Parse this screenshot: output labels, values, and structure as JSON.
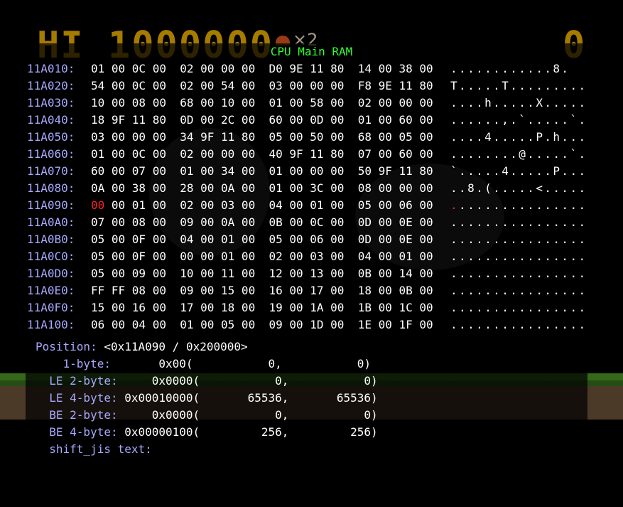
{
  "game": {
    "hi_label": "HI",
    "hi_score": "1000000",
    "lives": "×2",
    "score": "0"
  },
  "title": "CPU Main RAM",
  "rows": [
    {
      "addr": "11A010:",
      "b1": "01 00 0C 00",
      "b2": "02 00 00 00",
      "b3": "D0 9E 11 80",
      "b4": "14 00 38 00",
      "ascii": "............8."
    },
    {
      "addr": "11A020:",
      "b1": "54 00 0C 00",
      "b2": "02 00 54 00",
      "b3": "03 00 00 00",
      "b4": "F8 9E 11 80",
      "ascii": "T.....T........."
    },
    {
      "addr": "11A030:",
      "b1": "10 00 08 00",
      "b2": "68 00 10 00",
      "b3": "01 00 58 00",
      "b4": "02 00 00 00",
      "ascii": "....h.....X....."
    },
    {
      "addr": "11A040:",
      "b1": "18 9F 11 80",
      "b2": "0D 00 2C 00",
      "b3": "60 00 0D 00",
      "b4": "01 00 60 00",
      "ascii": "......,.`.....`."
    },
    {
      "addr": "11A050:",
      "b1": "03 00 00 00",
      "b2": "34 9F 11 80",
      "b3": "05 00 50 00",
      "b4": "68 00 05 00",
      "ascii": "....4.....P.h..."
    },
    {
      "addr": "11A060:",
      "b1": "01 00 0C 00",
      "b2": "02 00 00 00",
      "b3": "40 9F 11 80",
      "b4": "07 00 60 00",
      "ascii": "........@.....`."
    },
    {
      "addr": "11A070:",
      "b1": "60 00 07 00",
      "b2": "01 00 34 00",
      "b3": "01 00 00 00",
      "b4": "50 9F 11 80",
      "ascii": "`.....4.....P..."
    },
    {
      "addr": "11A080:",
      "b1": "0A 00 38 00",
      "b2": "28 00 0A 00",
      "b3": "01 00 3C 00",
      "b4": "08 00 00 00",
      "ascii": "..8.(.....<....."
    },
    {
      "addr": "11A090:",
      "b0": "00",
      "b1": " 00 01 00",
      "b2": "02 00 03 00",
      "b3": "04 00 01 00",
      "b4": "05 00 06 00",
      "ascii0": ".",
      "ascii": "..............."
    },
    {
      "addr": "11A0A0:",
      "b1": "07 00 08 00",
      "b2": "09 00 0A 00",
      "b3": "0B 00 0C 00",
      "b4": "0D 00 0E 00",
      "ascii": "................"
    },
    {
      "addr": "11A0B0:",
      "b1": "05 00 0F 00",
      "b2": "04 00 01 00",
      "b3": "05 00 06 00",
      "b4": "0D 00 0E 00",
      "ascii": "................"
    },
    {
      "addr": "11A0C0:",
      "b1": "05 00 0F 00",
      "b2": "00 00 01 00",
      "b3": "02 00 03 00",
      "b4": "04 00 01 00",
      "ascii": "................"
    },
    {
      "addr": "11A0D0:",
      "b1": "05 00 09 00",
      "b2": "10 00 11 00",
      "b3": "12 00 13 00",
      "b4": "0B 00 14 00",
      "ascii": "................"
    },
    {
      "addr": "11A0E0:",
      "b1": "FF FF 08 00",
      "b2": "09 00 15 00",
      "b3": "16 00 17 00",
      "b4": "18 00 0B 00",
      "ascii": "................"
    },
    {
      "addr": "11A0F0:",
      "b1": "15 00 16 00",
      "b2": "17 00 18 00",
      "b3": "19 00 1A 00",
      "b4": "1B 00 1C 00",
      "ascii": "................"
    },
    {
      "addr": "11A100:",
      "b1": "06 00 04 00",
      "b2": "01 00 05 00",
      "b3": "09 00 1D 00",
      "b4": "1E 00 1F 00",
      "ascii": "................"
    }
  ],
  "position": {
    "label": "Position:",
    "value": "<0x11A090 / 0x200000>"
  },
  "fields": [
    {
      "label": "    1-byte:",
      "hex": "       0x00(",
      "dec1": "           0,",
      "dec2": "           0)"
    },
    {
      "label": "  LE 2-byte:",
      "hex": "     0x0000(",
      "dec1": "           0,",
      "dec2": "           0)"
    },
    {
      "label": "  LE 4-byte:",
      "hex": " 0x00010000(",
      "dec1": "       65536,",
      "dec2": "       65536)"
    },
    {
      "label": "  BE 2-byte:",
      "hex": "     0x0000(",
      "dec1": "           0,",
      "dec2": "           0)"
    },
    {
      "label": "  BE 4-byte:",
      "hex": " 0x00000100(",
      "dec1": "         256,",
      "dec2": "         256)"
    }
  ],
  "shift_jis": {
    "label": "  shift_jis text:",
    "value": ""
  },
  "colors": {
    "title": "#30ff30",
    "address": "#a8a8ff",
    "bytes": "#ffffff",
    "cursor": "#ff2020"
  }
}
